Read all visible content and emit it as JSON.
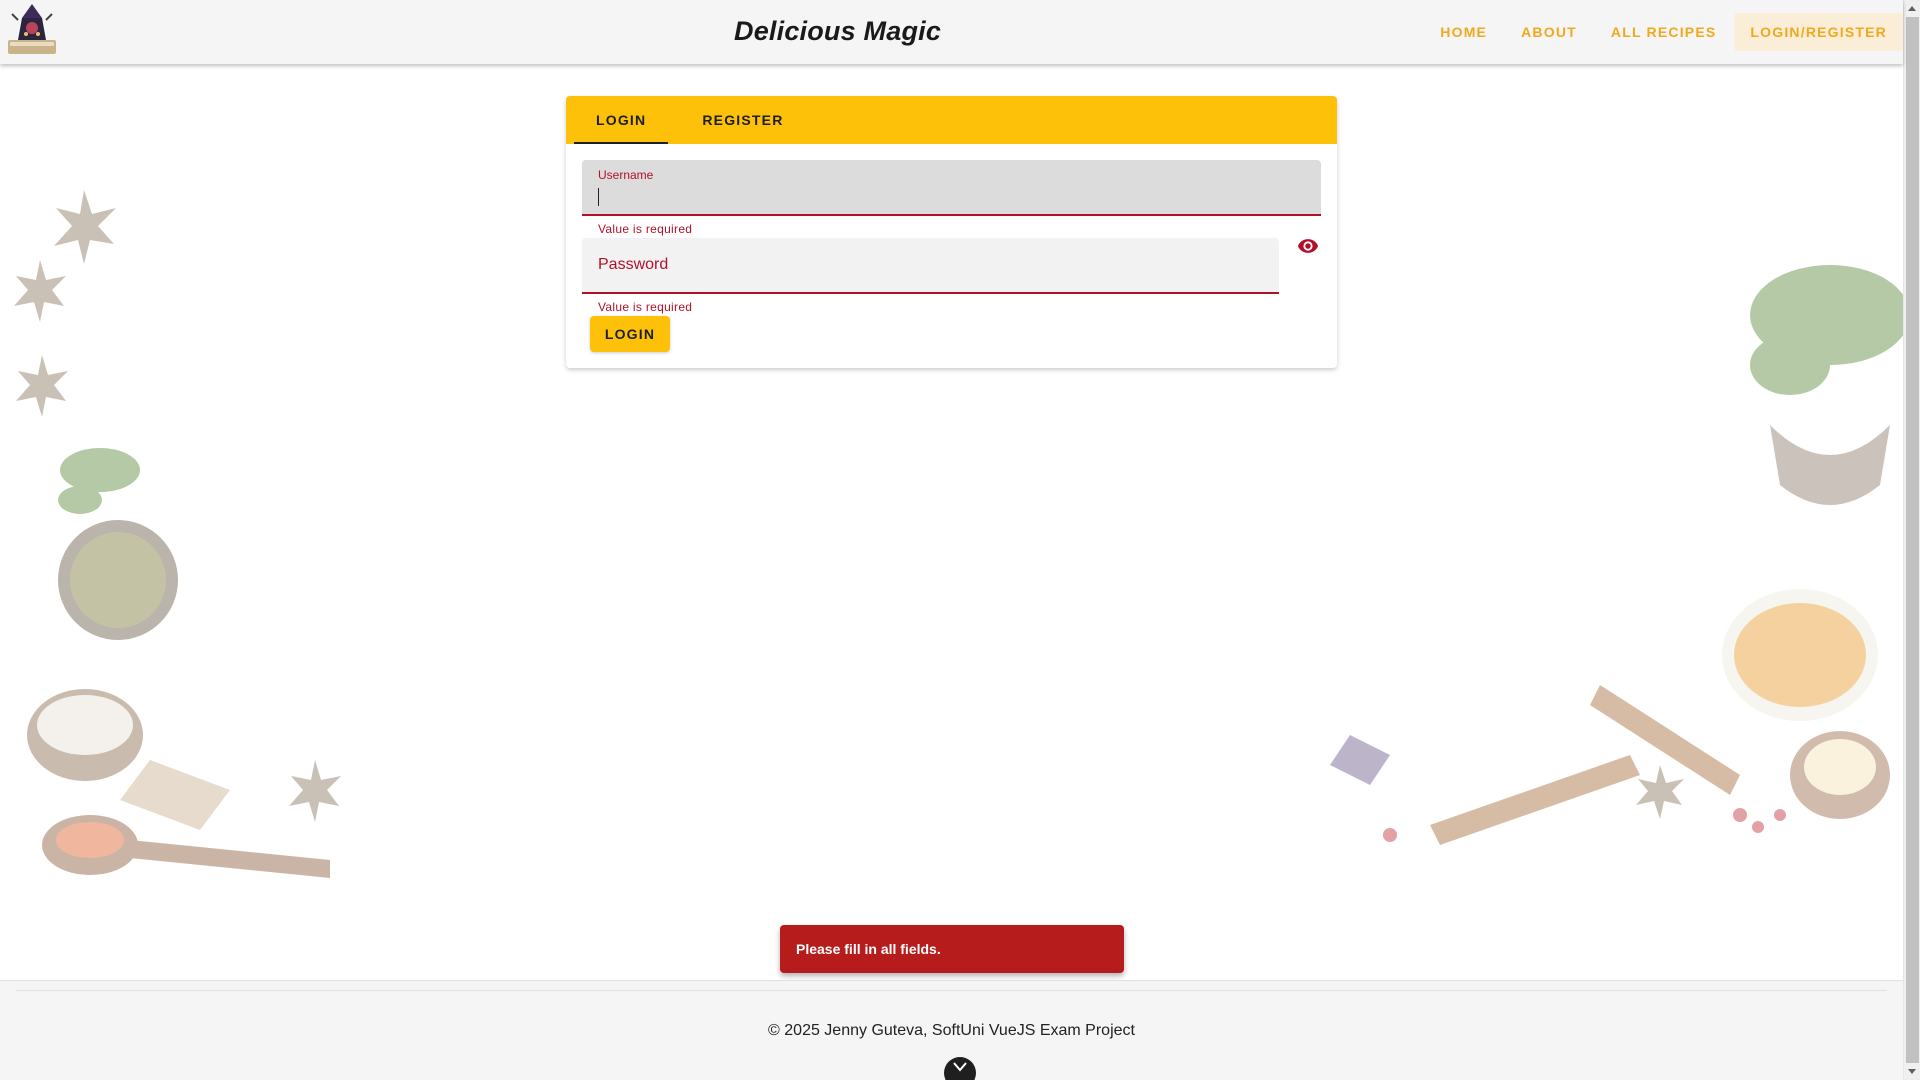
{
  "header": {
    "brand": "Delicious Magic",
    "nav": [
      {
        "label": "HOME"
      },
      {
        "label": "ABOUT"
      },
      {
        "label": "ALL RECIPES"
      },
      {
        "label": "LOGIN/REGISTER",
        "active": true
      }
    ]
  },
  "auth": {
    "tabs": [
      {
        "label": "LOGIN",
        "active": true
      },
      {
        "label": "REGISTER",
        "active": false
      }
    ],
    "username": {
      "label": "Username",
      "value": "",
      "error": "Value is required"
    },
    "password": {
      "label": "Password",
      "value": "",
      "error": "Value is required",
      "icon": "eye-icon"
    },
    "submit_label": "LOGIN"
  },
  "snackbar": {
    "message": "Please fill in all fields."
  },
  "footer": {
    "copyright": "© 2025 Jenny Guteva, SoftUni VueJS Exam Project",
    "scroll_icon": "chevron-down-icon"
  },
  "colors": {
    "accent": "#fdc109",
    "nav_text": "#f0a81c",
    "error": "#b0112a",
    "snackbar": "#b71c1c"
  }
}
